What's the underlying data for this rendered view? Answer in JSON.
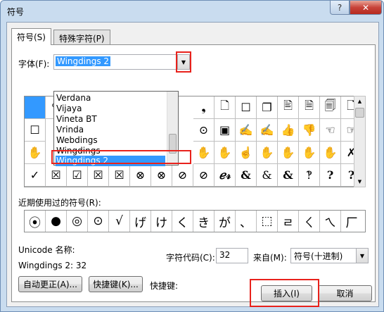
{
  "window": {
    "title": "符号",
    "help_label": "?",
    "close_label": "✕"
  },
  "tabs": [
    {
      "label": "符号(S)"
    },
    {
      "label": "特殊字符(P)"
    }
  ],
  "font": {
    "label": "字体(F):",
    "value": "Wingdings 2"
  },
  "font_dropdown": {
    "items": [
      "Verdana",
      "Vijaya",
      "Vineta BT",
      "Vrinda",
      "Webdings",
      "Wingdings",
      "Wingdings 2"
    ],
    "selected": "Wingdings 2"
  },
  "symbol_grid": {
    "rows": [
      [
        "",
        "✎",
        "",
        "",
        "",
        "",
        "",
        "✋",
        "❟",
        "🗋",
        "☐",
        "❐",
        "🖹",
        "🗎",
        "🗐",
        "🗋"
      ],
      [
        "☐",
        "",
        "",
        "",
        "",
        "",
        "",
        "",
        "⊙",
        "▣",
        "✍",
        "✍",
        "👍",
        "👎",
        "☜",
        "☞"
      ],
      [
        "✋",
        "",
        "",
        "",
        "",
        "",
        "",
        "",
        "✋",
        "✋",
        "☝",
        "✋",
        "✋",
        "✋",
        "✋",
        "✗"
      ],
      [
        "✓",
        "☒",
        "☑",
        "☒",
        "☒",
        "⊗",
        "⊗",
        "⊘",
        "⊘",
        "ℯ𝓇",
        "&",
        "&",
        "&",
        "‽",
        "?",
        "?"
      ]
    ]
  },
  "recent": {
    "label": "近期使用过的符号(R):",
    "symbols": [
      "⦿",
      "●",
      "◎",
      "⊙",
      "√",
      "げ",
      "け",
      "く",
      "き",
      "が",
      "、",
      "⬚",
      "ㄹ",
      "ㄑ",
      "ㄟ",
      "厂"
    ]
  },
  "unicode": {
    "label": "Unicode 名称:",
    "name": "Wingdings 2: 32"
  },
  "char_code": {
    "label": "字符代码(C):",
    "value": "32"
  },
  "from": {
    "label": "来自(M):",
    "value": "符号(十进制)"
  },
  "buttons": {
    "autocorrect": "自动更正(A)...",
    "shortcut_key": "快捷键(K)...",
    "shortcut_label": "快捷键:",
    "insert": "插入(I)",
    "cancel": "取消"
  }
}
